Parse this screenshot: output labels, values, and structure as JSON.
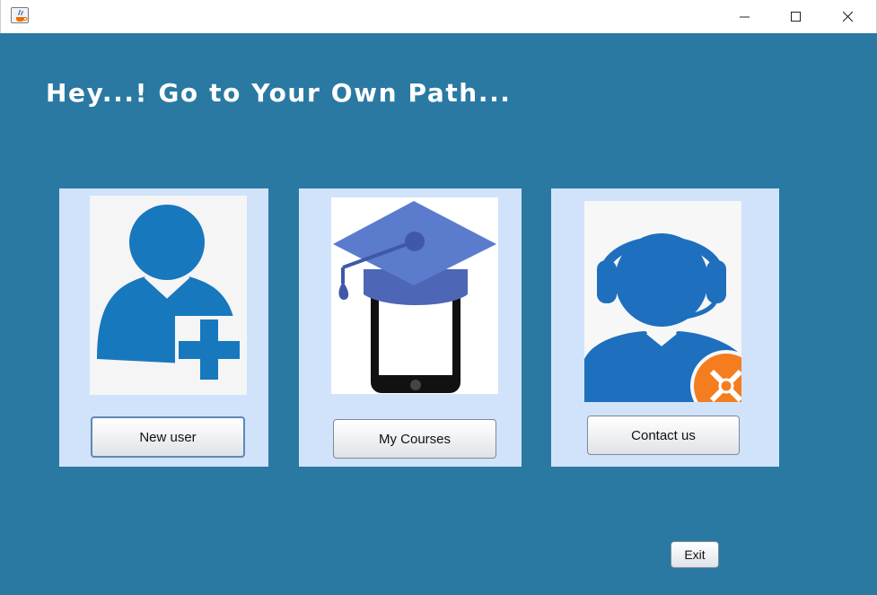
{
  "window": {
    "title": "",
    "controls": {
      "minimize": "minimize-icon",
      "maximize": "maximize-icon",
      "close": "close-icon"
    }
  },
  "main": {
    "heading": "Hey...! Go to Your Own Path...",
    "cards": [
      {
        "icon": "add-user-icon",
        "button_label": "New user"
      },
      {
        "icon": "graduation-cap-phone-icon",
        "button_label": "My Courses"
      },
      {
        "icon": "customer-support-headset-icon",
        "button_label": "Contact us"
      }
    ],
    "exit_label": "Exit"
  },
  "colors": {
    "background": "#2a79a3",
    "card": "#d1e3fb",
    "icon_blue": "#1778be",
    "support_blue": "#1e6fbe",
    "cap_blue": "#5676c8",
    "badge_orange": "#f47d20"
  }
}
